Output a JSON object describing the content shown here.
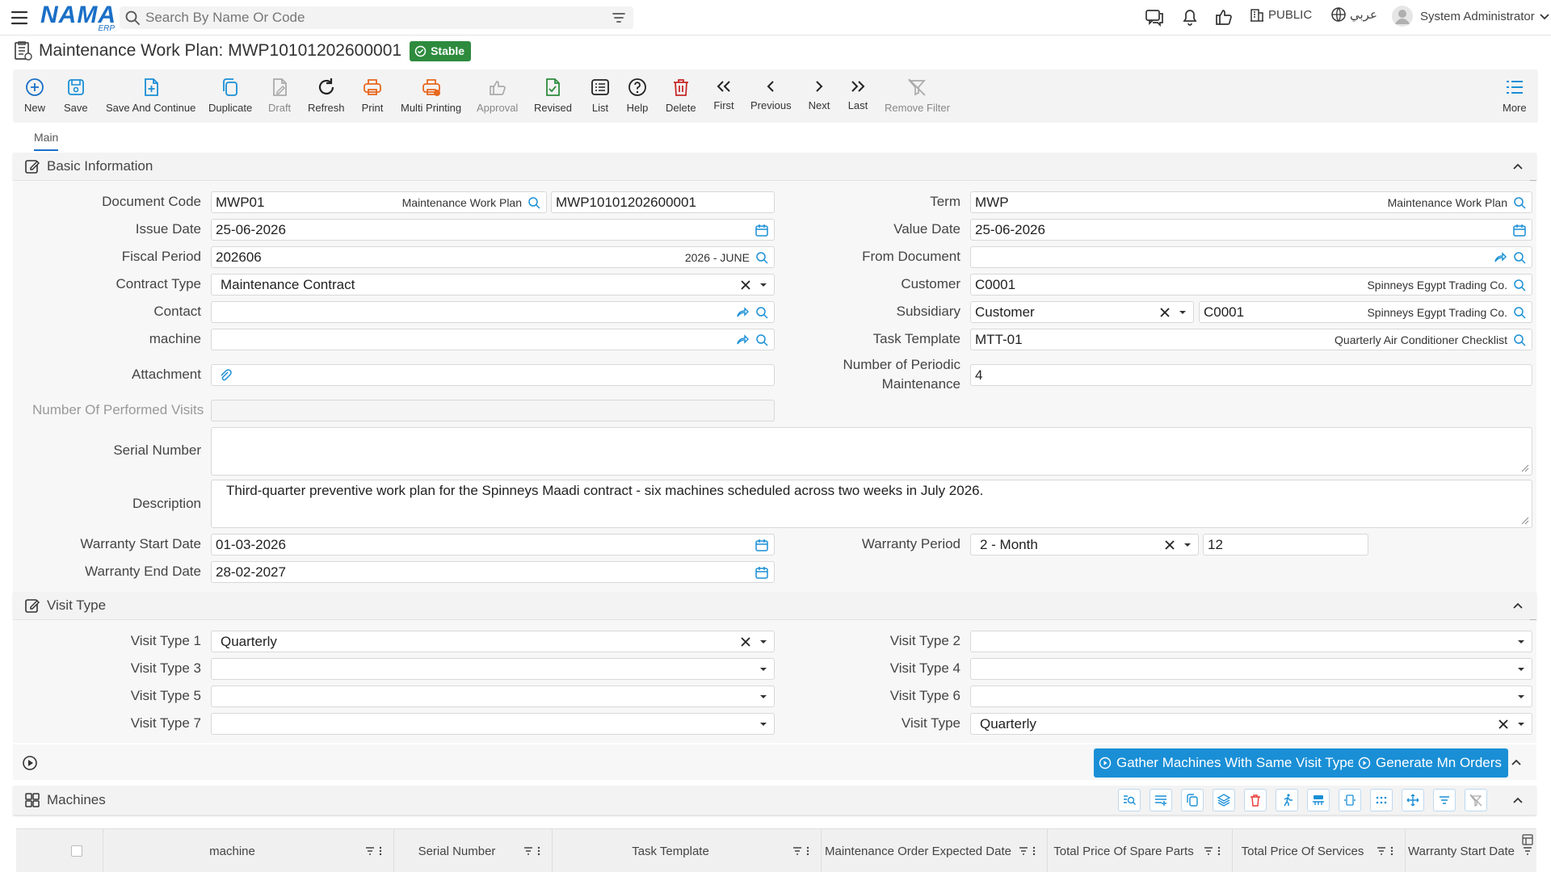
{
  "topbar": {
    "logo_text": "NAMA",
    "logo_sub": "ERP",
    "search_placeholder": "Search By Name Or Code",
    "scope_label": "PUBLIC",
    "language_label": "عربي",
    "user_name": "System Administrator"
  },
  "header": {
    "title": "Maintenance Work Plan: MWP10101202600001",
    "status": "Stable"
  },
  "toolbar": {
    "new": "New",
    "save": "Save",
    "save_continue": "Save And Continue",
    "duplicate": "Duplicate",
    "draft": "Draft",
    "refresh": "Refresh",
    "print": "Print",
    "multi_printing": "Multi Printing",
    "approval": "Approval",
    "revised": "Revised",
    "list": "List",
    "help": "Help",
    "delete": "Delete",
    "first": "First",
    "previous": "Previous",
    "next": "Next",
    "last": "Last",
    "remove_filter": "Remove Filter",
    "more": "More"
  },
  "tabs": {
    "main": "Main"
  },
  "basic": {
    "section_title": "Basic Information",
    "document_code": {
      "label": "Document Code",
      "value": "MWP01",
      "aux": "Maintenance Work Plan",
      "code": "MWP10101202600001"
    },
    "issue_date": {
      "label": "Issue Date",
      "value": "25-06-2026"
    },
    "fiscal_period": {
      "label": "Fiscal Period",
      "value": "202606",
      "aux": "2026 - JUNE"
    },
    "contract_type": {
      "label": "Contract Type",
      "value": "Maintenance Contract"
    },
    "contact": {
      "label": "Contact",
      "value": ""
    },
    "machine": {
      "label": "machine",
      "value": ""
    },
    "attachment": {
      "label": "Attachment"
    },
    "performed_visits": {
      "label": "Number Of Performed Visits",
      "value": ""
    },
    "serial_number": {
      "label": "Serial Number",
      "value": ""
    },
    "description": {
      "label": "Description",
      "value": "Third-quarter preventive work plan for the Spinneys Maadi contract - six machines scheduled across two weeks in July 2026."
    },
    "warranty_start": {
      "label": "Warranty Start Date",
      "value": "01-03-2026"
    },
    "warranty_end": {
      "label": "Warranty End Date",
      "value": "28-02-2027"
    },
    "term": {
      "label": "Term",
      "value": "MWP",
      "aux": "Maintenance Work Plan"
    },
    "value_date": {
      "label": "Value Date",
      "value": "25-06-2026"
    },
    "from_document": {
      "label": "From Document",
      "value": ""
    },
    "customer": {
      "label": "Customer",
      "value": "C0001",
      "aux": "Spinneys Egypt Trading Co."
    },
    "subsidiary": {
      "label": "Subsidiary",
      "type": "Customer",
      "value": "C0001",
      "aux": "Spinneys Egypt Trading Co."
    },
    "task_template": {
      "label": "Task Template",
      "value": "MTT-01",
      "aux": "Quarterly Air Conditioner Checklist"
    },
    "periodic_maintenance": {
      "label_line1": "Number of Periodic",
      "label_line2": "Maintenance",
      "value": "4"
    },
    "warranty_period": {
      "label": "Warranty Period",
      "unit": "2 - Month",
      "value": "12"
    }
  },
  "visit": {
    "section_title": "Visit Type",
    "vt1": {
      "label": "Visit Type 1",
      "value": "Quarterly"
    },
    "vt2": {
      "label": "Visit Type 2",
      "value": ""
    },
    "vt3": {
      "label": "Visit Type 3",
      "value": ""
    },
    "vt4": {
      "label": "Visit Type 4",
      "value": ""
    },
    "vt5": {
      "label": "Visit Type 5",
      "value": ""
    },
    "vt6": {
      "label": "Visit Type 6",
      "value": ""
    },
    "vt7": {
      "label": "Visit Type 7",
      "value": ""
    },
    "vt": {
      "label": "Visit Type",
      "value": "Quarterly"
    }
  },
  "actions": {
    "gather": "Gather Machines With Same Visit Type",
    "generate": "Generate Mn Orders"
  },
  "machines": {
    "section_title": "Machines",
    "columns": [
      "machine",
      "Serial Number",
      "Task Template",
      "Maintenance Order Expected Date",
      "Total Price Of Spare Parts",
      "Total Price Of Services",
      "Warranty Start Date"
    ]
  }
}
